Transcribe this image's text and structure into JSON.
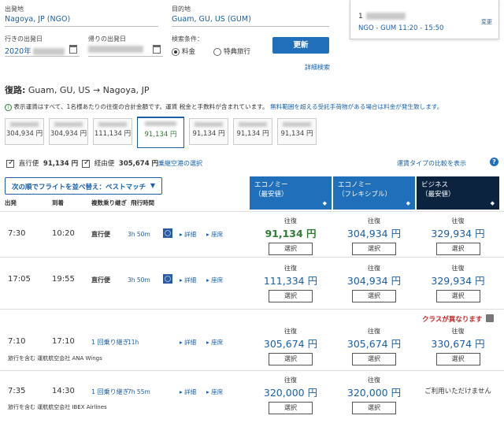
{
  "search": {
    "origin_label": "出発地",
    "origin_value": "Nagoya, JP (NGO)",
    "dest_label": "目的地",
    "dest_value": "Guam, GU, US (GUM)",
    "depart_label": "行きの出発日",
    "depart_value": "2020年",
    "return_label": "帰りの出発日",
    "condition_label": "検索条件：",
    "fare_option": "料金",
    "award_option": "特典旅行",
    "update_label": "更新",
    "advanced_link": "詳細検索"
  },
  "summary_box": {
    "route_time": "NGO - GUM 11:20 - 15:50",
    "change_link": "変更"
  },
  "route": {
    "prefix": "復路:",
    "from": "Guam, GU, US",
    "arrow": "→",
    "to": "Nagoya, JP"
  },
  "notice": {
    "text": "表示運賃はすべて、1名様あたりの往復の合計金額です。運賃 税金と手数料が含まれています。",
    "link": "無料範囲を超える受託手荷物がある場合は料金が発生致します。"
  },
  "date_tabs": [
    {
      "price": "304,934 円",
      "selected": false
    },
    {
      "price": "304,934 円",
      "selected": false
    },
    {
      "price": "111,134 円",
      "selected": false
    },
    {
      "price": "91,134 円",
      "selected": true
    },
    {
      "price": "91,134 円",
      "selected": false
    },
    {
      "price": "91,134 円",
      "selected": false
    },
    {
      "price": "91,134 円",
      "selected": false
    }
  ],
  "filters": {
    "nonstop_label": "直行便",
    "nonstop_price": "91,134 円",
    "connect_label": "経由便",
    "connect_price": "305,674 円",
    "seat_link": "乗継空港の選択",
    "compare_link": "運賃タイプの比較を表示"
  },
  "sort": {
    "label": "次の順でフライトを並べ替え：ベストマッチ"
  },
  "columns": {
    "depart": "出発",
    "arrive": "到着",
    "stops": "複数乗り継ぎ",
    "duration": "飛行時間",
    "economy_a": "エコノミー",
    "economy_a_sub": "（最安値）",
    "economy_b": "エコノミー",
    "economy_b_sub": "（フレキシブル）",
    "business": "ビジネス",
    "business_sub": "（最安値）"
  },
  "flights": [
    {
      "depart": "7:30",
      "arrive": "10:20",
      "stops": "直行便",
      "duration": "3h 50m",
      "details": "詳細",
      "seats": "座席",
      "fares": [
        {
          "label": "往復",
          "amount": "91,134 円",
          "select": "選択"
        },
        {
          "label": "往復",
          "amount": "304,934 円",
          "select": "選択"
        },
        {
          "label": "往復",
          "amount": "329,934 円",
          "select": "選択"
        }
      ]
    },
    {
      "depart": "17:05",
      "arrive": "19:55",
      "stops": "直行便",
      "duration": "3h 50m",
      "details": "詳細",
      "seats": "座席",
      "fares": [
        {
          "label": "往復",
          "amount": "111,334 円",
          "select": "選択"
        },
        {
          "label": "往復",
          "amount": "304,934 円",
          "select": "選択"
        },
        {
          "label": "往復",
          "amount": "329,934 円",
          "select": "選択"
        }
      ]
    },
    {
      "depart": "7:10",
      "arrive": "17:10",
      "stops": "1 回乗り継ぎ",
      "duration": "11h",
      "details": "詳細",
      "seats": "座席",
      "operated": "旅行を含む 運航航空会社 ANA Wings",
      "class_note": "クラスが異なります",
      "fares": [
        {
          "label": "往復",
          "amount": "305,674 円",
          "select": "選択"
        },
        {
          "label": "往復",
          "amount": "305,674 円",
          "select": "選択"
        },
        {
          "label": "往復",
          "amount": "330,674 円",
          "select": "選択"
        }
      ]
    },
    {
      "depart": "7:35",
      "arrive": "14:30",
      "stops": "1 回乗り継ぎ",
      "duration": "7h 55m",
      "details": "詳細",
      "seats": "座席",
      "operated": "旅行を含む 運航航空会社 IBEX Airlines",
      "fares": [
        {
          "label": "往復",
          "amount": "320,000 円",
          "select": "選択"
        },
        {
          "label": "往復",
          "amount": "320,000 円",
          "select": "選択"
        }
      ],
      "unavailable": "ご利用いただけません"
    }
  ],
  "colors": {
    "link": "#1a5fa8",
    "economy_header": "#1f6fba",
    "business_header": "#0c2340",
    "green_price": "#2e7d32",
    "alert": "#c62828"
  }
}
